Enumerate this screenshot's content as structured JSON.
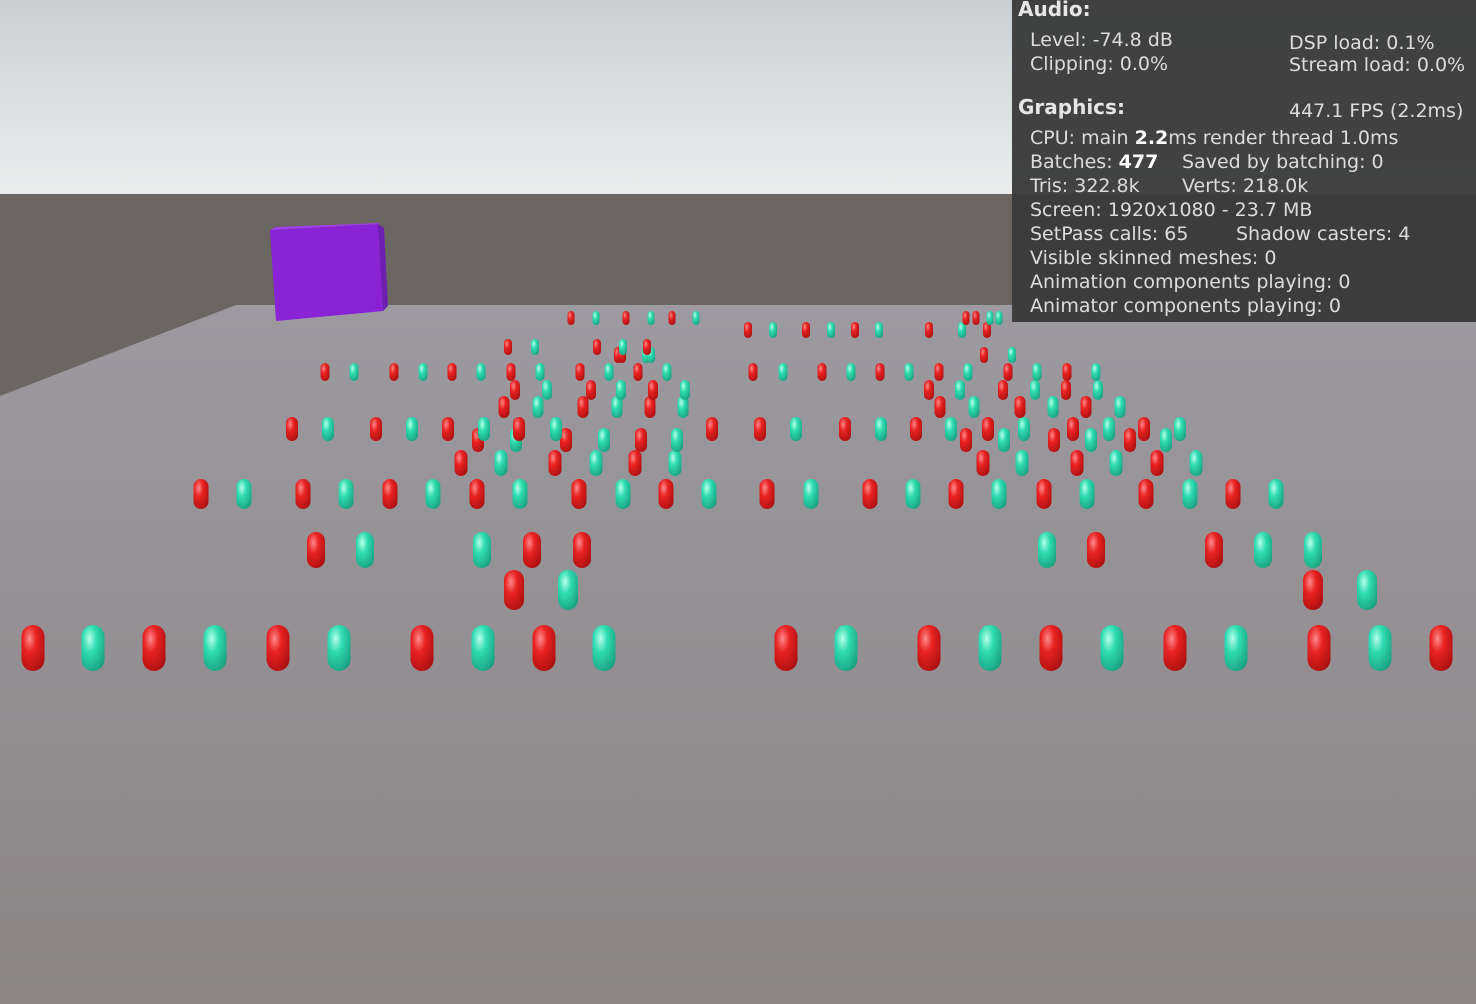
{
  "scene": {
    "sky_top": "#c9d0d2",
    "sky_bottom": "#eceeee",
    "ground_color": "#6c6663",
    "floor_color": "#8b8686",
    "cube_color": "#8522d6",
    "red_capsule_color": "#e02020",
    "teal_capsule_color": "#27d4a6"
  },
  "stats": {
    "audio": {
      "header": "Audio:",
      "level": "Level: -74.8 dB",
      "clipping": "Clipping: 0.0%",
      "dsp_load": "DSP load: 0.1%",
      "stream_load": "Stream load: 0.0%"
    },
    "graphics": {
      "header": "Graphics:",
      "fps": "447.1 FPS (2.2ms)",
      "cpu_prefix": "CPU: main ",
      "cpu_main": "2.2",
      "cpu_suffix": "ms  render thread 1.0ms",
      "batches_prefix": "Batches: ",
      "batches": "477",
      "saved_by_batching": "Saved by batching: 0",
      "tris": "Tris: 322.8k",
      "verts": "Verts: 218.0k",
      "screen": "Screen: 1920x1080 - 23.7 MB",
      "setpass": "SetPass calls: 65",
      "shadow_casters": "Shadow casters: 4",
      "visible_skinned": "Visible skinned meshes: 0",
      "animation_components": "Animation components playing: 0",
      "animator_components": "Animator components playing: 0"
    }
  }
}
